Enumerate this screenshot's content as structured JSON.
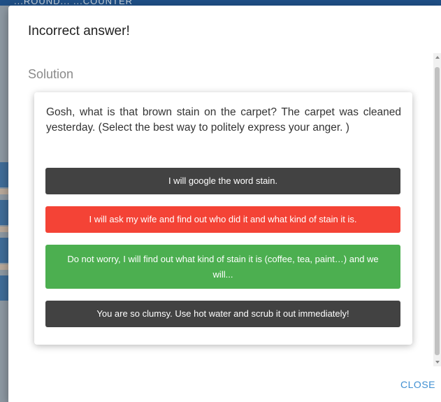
{
  "background": {
    "top_text": "...ROUND... ...COUNTER"
  },
  "dialog": {
    "title": "Incorrect answer!",
    "section_title": "Solution",
    "question": "Gosh, what is that brown stain on the carpet? The carpet was cleaned yesterday. (Select the best way to politely express your anger. )",
    "options": [
      {
        "label": "I will google the word stain.",
        "state": "neutral",
        "color": "#424242"
      },
      {
        "label": "I will ask my wife and find out who did it and what kind of stain it is.",
        "state": "selected-incorrect",
        "color": "#f44336"
      },
      {
        "label": "Do not worry, I will find out what kind of stain it is (coffee, tea, paint…) and we will...",
        "state": "correct",
        "color": "#4caf50"
      },
      {
        "label": "You are so clumsy. Use hot water and scrub it out immediately!",
        "state": "neutral",
        "color": "#424242"
      }
    ],
    "close_label": "CLOSE"
  },
  "colors": {
    "accent": "#3f8fd2",
    "correct": "#4caf50",
    "incorrect": "#f44336",
    "neutral": "#424242"
  }
}
